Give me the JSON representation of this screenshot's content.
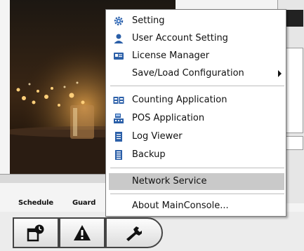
{
  "menu": {
    "items": [
      {
        "label": "Setting",
        "icon": "gear-icon"
      },
      {
        "label": "User Account Setting",
        "icon": "user-icon"
      },
      {
        "label": "License Manager",
        "icon": "license-card-icon"
      },
      {
        "label": "Save/Load Configuration",
        "icon": "",
        "submenu": true
      },
      {
        "label": "Counting Application",
        "icon": "counting-icon"
      },
      {
        "label": "POS Application",
        "icon": "pos-terminal-icon"
      },
      {
        "label": "Log Viewer",
        "icon": "log-document-icon"
      },
      {
        "label": "Backup",
        "icon": "backup-icon"
      },
      {
        "label": "Network Service",
        "icon": "",
        "highlighted": true
      },
      {
        "label": "About MainConsole...",
        "icon": ""
      }
    ]
  },
  "tabs": {
    "schedule": "Schedule",
    "guard": "Guard"
  },
  "toolbar": {
    "buttons": [
      {
        "icon": "schedule-clock-icon"
      },
      {
        "icon": "warning-triangle-icon"
      },
      {
        "icon": "wrench-tool-icon"
      }
    ]
  },
  "colors": {
    "highlight": "#c9c9c9",
    "menu_border": "#7a7a7a",
    "icon_blue": "#2b5fa8"
  }
}
